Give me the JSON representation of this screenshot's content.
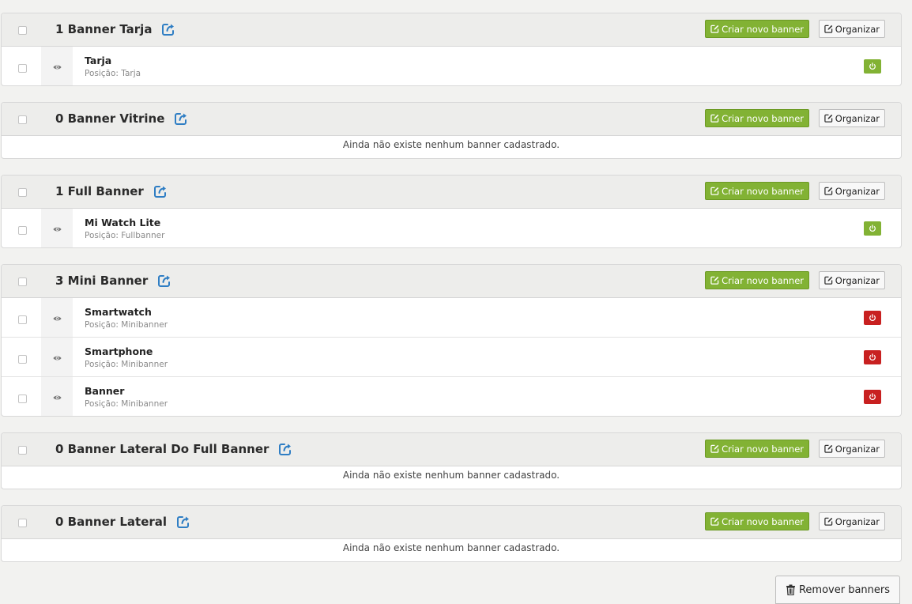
{
  "colors": {
    "accent_green": "#82b234",
    "status_off": "#c82020",
    "link_blue": "#2f7ec4"
  },
  "icons": {
    "open": "external-share-icon",
    "create": "edit-square-icon",
    "visibility": "eye-icon",
    "status": "power-icon",
    "remove": "trash-icon"
  },
  "sections": [
    {
      "title": "1 Banner Tarja",
      "create_label": "Criar novo banner",
      "organize_label": "Organizar",
      "banners": [
        {
          "name": "Tarja",
          "position": "Posição: Tarja",
          "active": true
        }
      ]
    },
    {
      "title": "0 Banner Vitrine",
      "create_label": "Criar novo banner",
      "organize_label": "Organizar",
      "banners": [],
      "empty_text": "Ainda não existe nenhum banner cadastrado."
    },
    {
      "title": "1 Full Banner",
      "create_label": "Criar novo banner",
      "organize_label": "Organizar",
      "banners": [
        {
          "name": "Mi Watch Lite",
          "position": "Posição: Fullbanner",
          "active": true
        }
      ]
    },
    {
      "title": "3 Mini Banner",
      "create_label": "Criar novo banner",
      "organize_label": "Organizar",
      "banners": [
        {
          "name": "Smartwatch",
          "position": "Posição: Minibanner",
          "active": false
        },
        {
          "name": "Smartphone",
          "position": "Posição: Minibanner",
          "active": false
        },
        {
          "name": "Banner",
          "position": "Posição: Minibanner",
          "active": false
        }
      ]
    },
    {
      "title": "0 Banner Lateral Do Full Banner",
      "create_label": "Criar novo banner",
      "organize_label": "Organizar",
      "banners": [],
      "empty_text": "Ainda não existe nenhum banner cadastrado."
    },
    {
      "title": "0 Banner Lateral",
      "create_label": "Criar novo banner",
      "organize_label": "Organizar",
      "banners": [],
      "empty_text": "Ainda não existe nenhum banner cadastrado."
    }
  ],
  "remove_button": {
    "label": "Remover banners"
  }
}
